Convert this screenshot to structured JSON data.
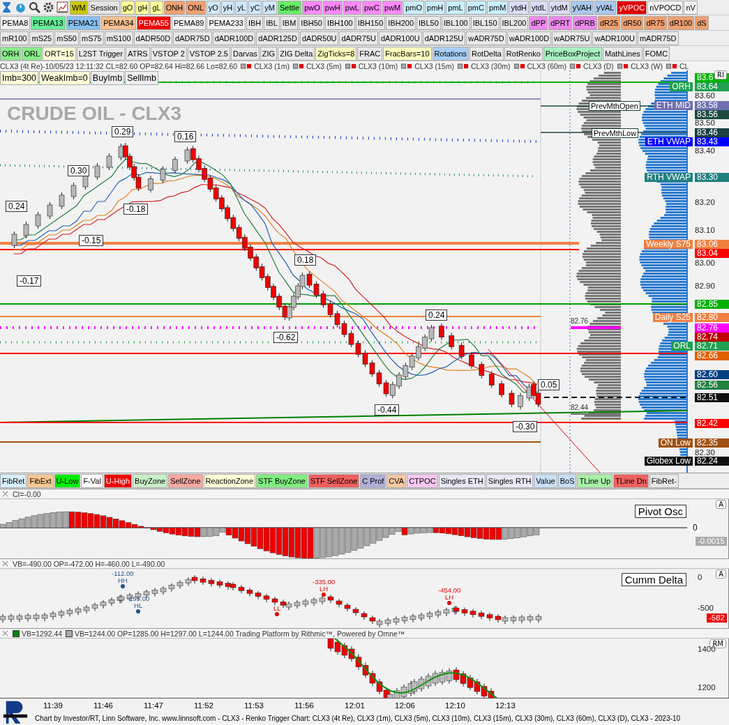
{
  "toolbar_rows": [
    [
      {
        "label": "WM",
        "color": "#c8c800"
      },
      {
        "label": "Session",
        "color": "#e4e4e4"
      },
      {
        "label": "gO",
        "color": "#ffff99"
      },
      {
        "label": "gH",
        "color": "#ffff99"
      },
      {
        "label": "gL",
        "color": "#ffff99"
      },
      {
        "label": "ONH",
        "color": "#f0a070"
      },
      {
        "label": "ONL",
        "color": "#f0a070"
      },
      {
        "label": "yO",
        "color": "#cfe8ff"
      },
      {
        "label": "yH",
        "color": "#cfe8ff"
      },
      {
        "label": "yL",
        "color": "#cfe8ff"
      },
      {
        "label": "yC",
        "color": "#cfe8ff"
      },
      {
        "label": "yM",
        "color": "#cfe8ff"
      },
      {
        "label": "Settle",
        "color": "#66ee66"
      },
      {
        "label": "pwO",
        "color": "#ff88ff"
      },
      {
        "label": "pwH",
        "color": "#ff88ff"
      },
      {
        "label": "pwL",
        "color": "#ff88ff"
      },
      {
        "label": "pwC",
        "color": "#ff88ff"
      },
      {
        "label": "pwM",
        "color": "#ff88ff"
      },
      {
        "label": "pmO",
        "color": "#c8f0ff"
      },
      {
        "label": "pmH",
        "color": "#c8f0ff"
      },
      {
        "label": "pmL",
        "color": "#c8f0ff"
      },
      {
        "label": "pmC",
        "color": "#c8f0ff"
      },
      {
        "label": "pmM",
        "color": "#c8f0ff"
      },
      {
        "label": "ytdH",
        "color": "#dcdcf8"
      },
      {
        "label": "ytdL",
        "color": "#dcdcf8"
      },
      {
        "label": "ytdM",
        "color": "#dcdcf8"
      },
      {
        "label": "yVAH",
        "color": "#a8c8f0"
      },
      {
        "label": "yVAL",
        "color": "#a8c8f0"
      },
      {
        "label": "yVPOC",
        "color": "#e00000"
      },
      {
        "label": "nVPOCD",
        "color": "#f2f2f2"
      },
      {
        "label": "nV",
        "color": "#f2f2f2"
      }
    ],
    [
      {
        "label": "PEMA8",
        "color": "#f2f2f2"
      },
      {
        "label": "PEMA13",
        "color": "#66ee99"
      },
      {
        "label": "PEMA21",
        "color": "#88c0f0"
      },
      {
        "label": "PEMA34",
        "color": "#f8c090"
      },
      {
        "label": "PEMA55",
        "color": "#ee0000"
      },
      {
        "label": "PEMA89",
        "color": "#f2f2f2"
      },
      {
        "label": "PEMA233",
        "color": "#f2f2f2"
      },
      {
        "label": "IBH",
        "color": "#e8e8e8"
      },
      {
        "label": "IBL",
        "color": "#e8e8e8"
      },
      {
        "label": "IBM",
        "color": "#e8e8e8"
      },
      {
        "label": "IBH50",
        "color": "#e8e8e8"
      },
      {
        "label": "IBH100",
        "color": "#e8e8e8"
      },
      {
        "label": "IBH150",
        "color": "#e8e8e8"
      },
      {
        "label": "IBH200",
        "color": "#e8e8e8"
      },
      {
        "label": "IBL50",
        "color": "#e8e8e8"
      },
      {
        "label": "IBL100",
        "color": "#e8e8e8"
      },
      {
        "label": "IBL150",
        "color": "#e8e8e8"
      },
      {
        "label": "IBL200",
        "color": "#e8e8e8"
      },
      {
        "label": "dPP",
        "color": "#ee88ee"
      },
      {
        "label": "dPRT",
        "color": "#ee88ee"
      },
      {
        "label": "dPRB",
        "color": "#ee88ee"
      },
      {
        "label": "dR25",
        "color": "#f0a070"
      },
      {
        "label": "dR50",
        "color": "#f0a070"
      },
      {
        "label": "dR75",
        "color": "#f0a070"
      },
      {
        "label": "dR100",
        "color": "#f0a070"
      },
      {
        "label": "dS",
        "color": "#f0a070"
      }
    ],
    [
      {
        "label": "mR100",
        "color": "#e8e8e8"
      },
      {
        "label": "mS25",
        "color": "#e8e8e8"
      },
      {
        "label": "mS50",
        "color": "#e8e8e8"
      },
      {
        "label": "mS75",
        "color": "#e8e8e8"
      },
      {
        "label": "mS100",
        "color": "#e8e8e8"
      },
      {
        "label": "dADR50D",
        "color": "#e8e8e8"
      },
      {
        "label": "dADR75D",
        "color": "#e8e8e8"
      },
      {
        "label": "dADR100D",
        "color": "#e8e8e8"
      },
      {
        "label": "dADR125D",
        "color": "#e8e8e8"
      },
      {
        "label": "dADR50U",
        "color": "#e8e8e8"
      },
      {
        "label": "dADR75U",
        "color": "#e8e8e8"
      },
      {
        "label": "dADR100U",
        "color": "#e8e8e8"
      },
      {
        "label": "dADR125U",
        "color": "#e8e8e8"
      },
      {
        "label": "wADR75D",
        "color": "#e8e8e8"
      },
      {
        "label": "wADR100D",
        "color": "#e8e8e8"
      },
      {
        "label": "wADR75U",
        "color": "#e8e8e8"
      },
      {
        "label": "wADR100U",
        "color": "#e8e8e8"
      },
      {
        "label": "mADR75D",
        "color": "#e8e8e8"
      }
    ],
    [
      {
        "label": "ORH",
        "color": "#88ee88"
      },
      {
        "label": "ORL",
        "color": "#88ee88"
      },
      {
        "label": "ORT=15",
        "color": "#ffffd8"
      },
      {
        "label": "L2ST Trigger",
        "color": "#e8e8e8"
      },
      {
        "label": "ATRS",
        "color": "#e8e8e8"
      },
      {
        "label": "VSTOP 2",
        "color": "#e8e8e8"
      },
      {
        "label": "VSTOP 2.5",
        "color": "#e8e8e8"
      },
      {
        "label": "Darvas",
        "color": "#e8e8e8"
      },
      {
        "label": "ZIG",
        "color": "#e8e8e8"
      },
      {
        "label": "ZIG Delta",
        "color": "#e8e8e8"
      },
      {
        "label": "ZigTicks=8",
        "color": "#ffffc0"
      },
      {
        "label": "FRAC",
        "color": "#e8e8e8"
      },
      {
        "label": "FracBars=10",
        "color": "#ffffc0"
      },
      {
        "label": "Rotations",
        "color": "#a8d0f8"
      },
      {
        "label": "RotDelta",
        "color": "#e8e8e8"
      },
      {
        "label": "RotRenko",
        "color": "#e8e8e8"
      },
      {
        "label": "PriceBoxProject",
        "color": "#a8f0c0"
      },
      {
        "label": "MathLines",
        "color": "#e8e8e8"
      },
      {
        "label": "FOMC",
        "color": "#e8e8e8"
      }
    ]
  ],
  "legend": {
    "main": "CLX3 (4t Re)-10/05/23 12:11:32 CL=82.60 OP=82.64 Hi=82.66 Lo=82.60",
    "series": [
      "CLX3 (1m)",
      "CLX3 (5m)",
      "CLX3 (10m)",
      "CLX3 (15m)",
      "CLX3 (30m)",
      "CLX3 (60m)",
      "CLX3 (D)",
      "CLX3 (W)",
      "CL"
    ]
  },
  "imbalance_buttons": [
    {
      "label": "Imb=300"
    },
    {
      "label": "WeakImb=0"
    },
    {
      "label": "BuyImb"
    },
    {
      "label": "SellImb"
    }
  ],
  "main_chart": {
    "watermark": "CRUDE OIL - CLX3",
    "corner_label": "RI",
    "swing_labels": [
      "0.29",
      "0.16",
      "0.30",
      "-0.18",
      "0.24",
      "-0.15",
      "-0.17",
      "0.18",
      "-0.62",
      "0.24",
      "-0.44",
      "0.05",
      "-0.30"
    ],
    "profile_labels": [
      "82.76",
      "82.44"
    ],
    "level_notes": [
      "PrevMthOpen",
      "PrevMthLow"
    ],
    "price_ticks": [
      "83.60",
      "83.50",
      "83.40",
      "83.20",
      "83.10",
      "83.00",
      "82.90",
      "82.30"
    ],
    "price_tags": [
      {
        "price": "83.6",
        "color": "#00b000"
      },
      {
        "label": "ORH",
        "price": "83.64",
        "color": "#20a050"
      },
      {
        "label": "ETH MID",
        "price": "83.58",
        "color": "#7070b0"
      },
      {
        "price": "83.56",
        "color": "#1a4a40"
      },
      {
        "price": "83.46",
        "color": "#1a4040"
      },
      {
        "label": "ETH VWAP",
        "price": "83.43",
        "color": "#0000ff"
      },
      {
        "label": "RTH VWAP",
        "price": "83.30",
        "color": "#208080"
      },
      {
        "label": "Weekly S75",
        "price": "83.06",
        "color": "#f08040"
      },
      {
        "price": "83.04",
        "color": "#ff0000"
      },
      {
        "price": "82.85",
        "color": "#00b000"
      },
      {
        "label": "Daily S25",
        "price": "82.80",
        "color": "#f08040"
      },
      {
        "price": "82.76",
        "color": "#ff00ff"
      },
      {
        "price": "82.74",
        "color": "#c00000"
      },
      {
        "label": "ORL",
        "price": "82.71",
        "color": "#20a050"
      },
      {
        "price": "82.66",
        "color": "#e06000"
      },
      {
        "price": "82.60",
        "color": "#004080"
      },
      {
        "price": "82.56",
        "color": "#208040"
      },
      {
        "price": "82.51",
        "color": "#101010"
      },
      {
        "price": "82.42",
        "color": "#ff0000"
      },
      {
        "label": "ON Low",
        "price": "82.35",
        "color": "#a05010"
      },
      {
        "label": "Globex Low",
        "price": "82.24",
        "color": "#101010"
      }
    ]
  },
  "study_bar": [
    {
      "label": "FibRet",
      "color": "#d8f0ff"
    },
    {
      "label": "FibExt",
      "color": "#f8c890"
    },
    {
      "label": "U-Low",
      "color": "#00ee00"
    },
    {
      "label": "F-Val",
      "color": "#ffffff"
    },
    {
      "label": "U-High",
      "color": "#ee0000"
    },
    {
      "label": "BuyZone",
      "color": "#c8f0c8"
    },
    {
      "label": "SellZone",
      "color": "#f8a8a0"
    },
    {
      "label": "ReactionZone",
      "color": "#ffffd8"
    },
    {
      "label": "STF BuyZone",
      "color": "#80ee80"
    },
    {
      "label": "STF SellZone",
      "color": "#f06060"
    },
    {
      "label": "C Prof",
      "color": "#b0b0d8"
    },
    {
      "label": "CVA",
      "color": "#f8c8a0"
    },
    {
      "label": "CTPOC",
      "color": "#f8c8f0"
    },
    {
      "label": "Singles ETH",
      "color": "#e8e8f8"
    },
    {
      "label": "Singles RTH",
      "color": "#e8e8f8"
    },
    {
      "label": "Value",
      "color": "#c8e0f8"
    },
    {
      "label": "BoS",
      "color": "#c8e0f8"
    },
    {
      "label": "TLine Up",
      "color": "#a8f0a8"
    },
    {
      "label": "TLine Dn",
      "color": "#f06060"
    },
    {
      "label": "FibRet-",
      "color": "#e8e8e8"
    }
  ],
  "pivot_osc": {
    "header": "CI=-0.00",
    "title": "Pivot Osc",
    "corner_label": "A",
    "zero_tick": "0",
    "current": "-0.0015"
  },
  "cumm_delta": {
    "header": "VB=-490.00 OP=-472.00 H=-460.00 L=-490.00",
    "title": "Cumm Delta",
    "corner_label": "A",
    "ticks": [
      "0",
      "-500"
    ],
    "current": "-582",
    "swing_labels": [
      {
        "value": "-112.00",
        "tag": "HH",
        "color": "#1f4e8c"
      },
      {
        "value": "-199.00",
        "tag": "HL",
        "color": "#1f4e8c"
      },
      {
        "tag": "LL",
        "color": "#e00000"
      },
      {
        "value": "-335.00",
        "tag": "LH",
        "color": "#e00000"
      },
      {
        "value": "-454.00",
        "tag": "LH",
        "color": "#e00000"
      }
    ]
  },
  "volume": {
    "header_1": "VB=1292.44",
    "header_2": "VB=1244.00 OP=1285.00 H=1297.00 L=1244.00  Trading Platform by Rithmic™, Powered by Omne™",
    "corner_label": "RM",
    "ticks": [
      "1400",
      "1200"
    ]
  },
  "time_axis": [
    "11:39",
    "11:46",
    "11:47",
    "11:52",
    "11:53",
    "11:56",
    "12:01",
    "12:06",
    "12:10",
    "12:13"
  ],
  "footer": "Chart by Investor/RT, Linn Software, Inc. www.linnsoft.com - CLX3 - Renko Trigger Chart: CLX3 (4t Re), CLX3 (1m), CLX3 (5m), CLX3 (10m), CLX3 (15m), CLX3 (30m), CLX3 (60m), CLX3 (D), CLX3  - 2023-10"
}
